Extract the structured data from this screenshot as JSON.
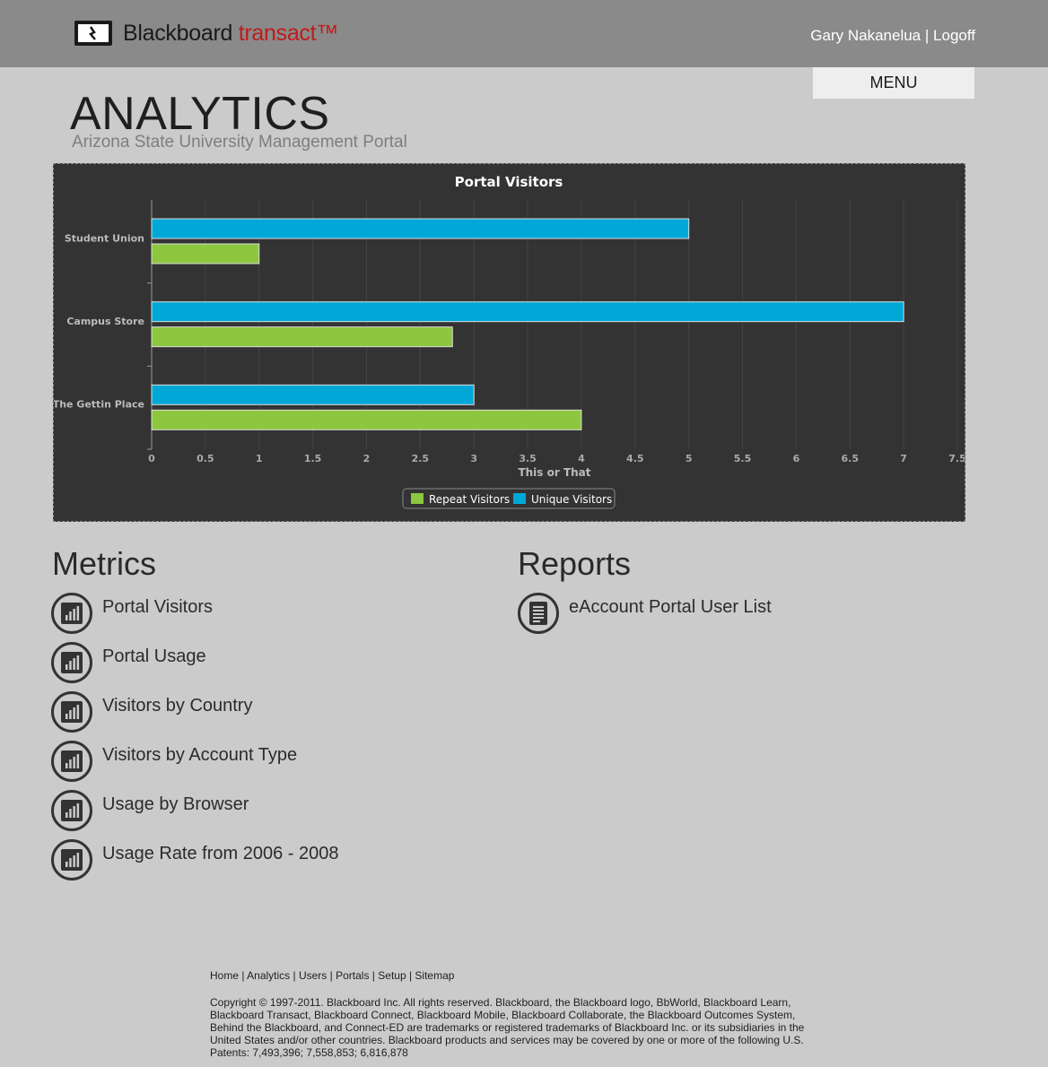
{
  "header": {
    "logo_main": "Blackboard",
    "logo_accent": "transact™",
    "user_name": "Gary Nakanelua",
    "separator": "|",
    "logoff": "Logoff",
    "menu": "MENU"
  },
  "page": {
    "title": "ANALYTICS",
    "subtitle": "Arizona State University Management Portal"
  },
  "chart_data": {
    "type": "bar",
    "orientation": "horizontal",
    "title": "Portal Visitors",
    "xlabel": "This or That",
    "ylabel": "",
    "categories": [
      "Student Union",
      "Campus Store",
      "The Gettin Place"
    ],
    "series": [
      {
        "name": "Unique Visitors",
        "color": "#00a8d8",
        "values": [
          5,
          7,
          3
        ]
      },
      {
        "name": "Repeat Visitors",
        "color": "#8dc63f",
        "values": [
          1,
          2.8,
          4
        ]
      }
    ],
    "legend_order": [
      "Repeat Visitors",
      "Unique Visitors"
    ],
    "xlim": [
      0,
      7.5
    ],
    "xticks": [
      "0",
      "0.5",
      "1",
      "1.5",
      "2",
      "2.5",
      "3",
      "3.5",
      "4",
      "4.5",
      "5",
      "5.5",
      "6",
      "6.5",
      "7",
      "7.5"
    ],
    "grid": true,
    "legend_placement": "bottom-center"
  },
  "metrics": {
    "title": "Metrics",
    "items": [
      {
        "label": "Portal Visitors"
      },
      {
        "label": "Portal Usage"
      },
      {
        "label": "Visitors by Country"
      },
      {
        "label": "Visitors by Account Type"
      },
      {
        "label": "Usage by Browser"
      },
      {
        "label": "Usage Rate from 2006 - 2008"
      }
    ]
  },
  "reports": {
    "title": "Reports",
    "items": [
      {
        "label": "eAccount Portal User List"
      }
    ]
  },
  "footer": {
    "links": [
      "Home",
      "Analytics",
      "Users",
      "Portals",
      "Setup",
      "Sitemap"
    ],
    "separator": " | ",
    "copyright": "Copyright © 1997-2011. Blackboard Inc. All rights reserved. Blackboard, the Blackboard logo, BbWorld, Blackboard Learn, Blackboard Transact, Blackboard Connect, Blackboard Mobile, Blackboard Collaborate, the Blackboard Outcomes System, Behind the Blackboard, and Connect-ED are trademarks or registered trademarks of Blackboard Inc. or its subsidiaries in the United States and/or other countries. Blackboard products and services may be covered by one or more of the following U.S. Patents: 7,493,396; 7,558,853; 6,816,878"
  },
  "colors": {
    "header_bg": "#8a8a8a",
    "page_bg": "#cbcbcb",
    "chart_bg": "#333333",
    "logo_accent": "#c01b1b"
  },
  "icons": {
    "metric_icon": "bar-chart-icon",
    "report_icon": "document-icon",
    "logo_icon": "blackboard-logo-icon"
  }
}
